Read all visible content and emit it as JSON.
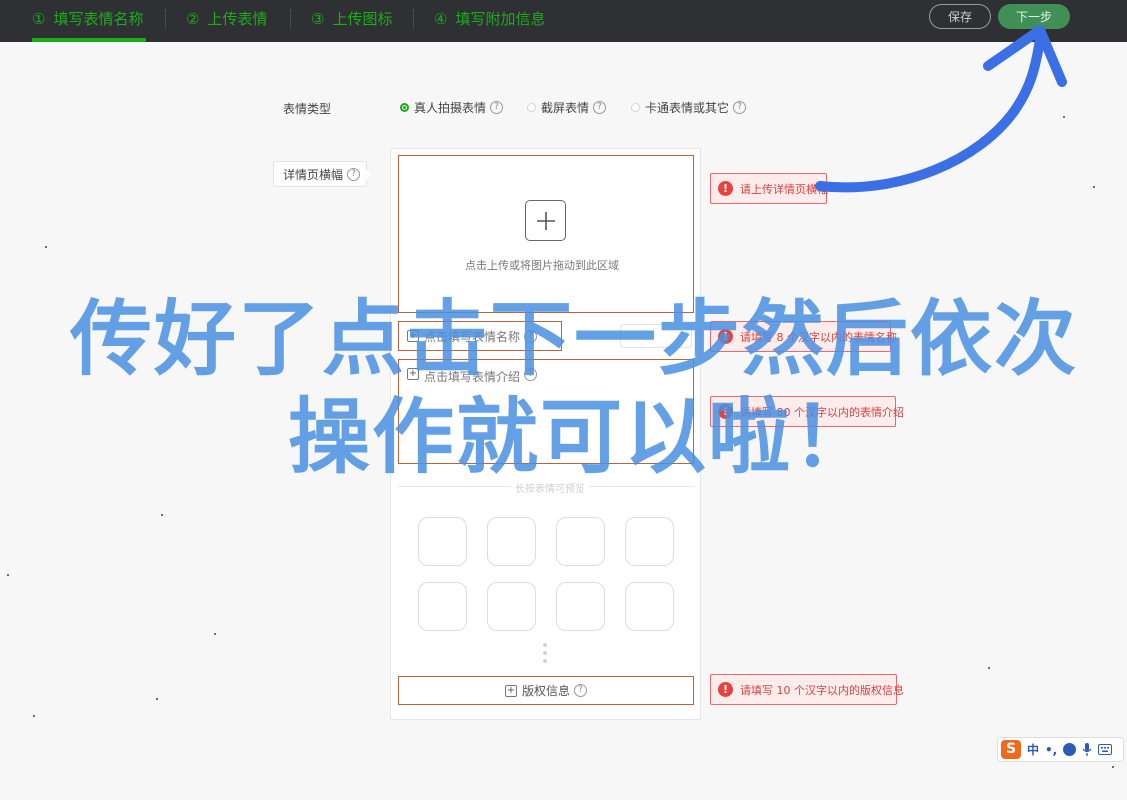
{
  "steps": [
    {
      "num": "①",
      "label": "填写表情名称",
      "active": true
    },
    {
      "num": "②",
      "label": "上传表情",
      "active": false
    },
    {
      "num": "③",
      "label": "上传图标",
      "active": false
    },
    {
      "num": "④",
      "label": "填写附加信息",
      "active": false
    }
  ],
  "actions": {
    "save_label": "保存",
    "next_label": "下一步"
  },
  "type_row": {
    "label": "表情类型",
    "options": [
      "真人拍摄表情",
      "截屏表情",
      "卡通表情或其它"
    ],
    "selected": "真人拍摄表情"
  },
  "banner": {
    "label": "详情页横幅",
    "upload_hint": "点击上传或将图片拖动到此区域"
  },
  "fields": {
    "name_placeholder": "点击填写表情名称",
    "intro_placeholder": "点击填写表情介绍",
    "preview_hint": "长按表情可预览",
    "copyright_label": "版权信息"
  },
  "errors": {
    "banner": "请上传详情页横幅",
    "name": "请填写 8 个汉字以内的表情名称",
    "intro": "请填写 80 个汉字以内的表情介绍",
    "copyright": "请填写 10 个汉字以内的版权信息"
  },
  "overlay": {
    "line1": "传好了点击下一步然后依次",
    "line2": "操作就可以啦！"
  },
  "ime": {
    "logo": "S",
    "mode": "中",
    "punct": "•,"
  },
  "colors": {
    "accent": "#1aad19",
    "error": "#e64340",
    "overlay": "#4a90e2",
    "field_border": "#b8653e"
  }
}
